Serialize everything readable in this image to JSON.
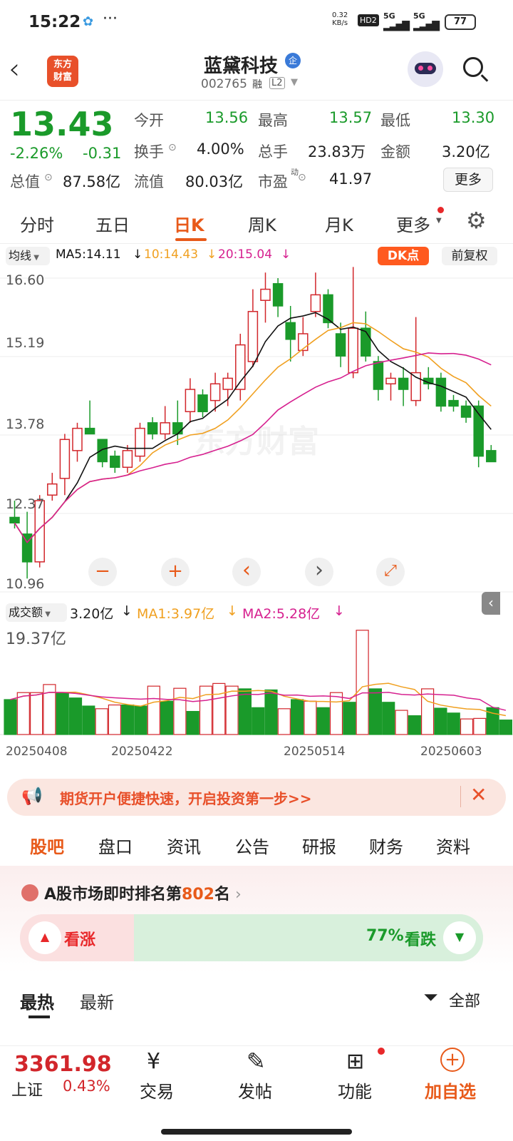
{
  "status": {
    "time": "15:22",
    "net_speed": "0.32",
    "net_unit": "KB/s",
    "hd": "HD2",
    "sig1": "5G",
    "sig2": "5G",
    "battery": "77"
  },
  "header": {
    "logo_line1": "东方",
    "logo_line2": "财富",
    "title": "蓝黛科技",
    "title_badge": "企",
    "code": "002765",
    "tag_rong": "融",
    "tag_level": "L2"
  },
  "quote": {
    "price": "13.43",
    "change_pct": "-2.26%",
    "change": "-0.31",
    "open_label": "今开",
    "open": "13.56",
    "high_label": "最高",
    "high": "13.57",
    "low_label": "最低",
    "low": "13.30",
    "turnover_label": "换手",
    "turnover": "4.00%",
    "volume_label": "总手",
    "volume": "23.83万",
    "amount_label": "金额",
    "amount": "3.20亿",
    "mktcap_label": "总值",
    "mktcap": "87.58亿",
    "float_label": "流值",
    "float": "80.03亿",
    "pe_label": "市盈",
    "pe_sup": "动",
    "pe": "41.97",
    "more_btn": "更多"
  },
  "tabs": [
    "分时",
    "五日",
    "日K",
    "周K",
    "月K",
    "更多"
  ],
  "active_tab_index": 2,
  "kline": {
    "ma_label": "均线",
    "ma5": "MA5:14.11",
    "ma10": "10:14.43",
    "ma20": "20:15.04",
    "dk_btn": "DK点",
    "adj_btn": "前复权",
    "yticks": [
      "16.60",
      "15.19",
      "13.78",
      "12.37",
      "10.96"
    ],
    "watermark": "东方财富",
    "controls": [
      "−",
      "+",
      "‹",
      "›",
      "⤢"
    ],
    "colors": {
      "ma5": "#111111",
      "ma10": "#f0a020",
      "ma20": "#d6208f",
      "up": "#d2262b",
      "down": "#1a9a2a"
    }
  },
  "chart_data": {
    "type": "candlestick",
    "candles": [
      [
        12.3,
        12.6,
        12.1,
        12.2
      ],
      [
        12.0,
        12.4,
        11.2,
        11.5
      ],
      [
        11.5,
        12.7,
        11.4,
        12.6
      ],
      [
        12.7,
        13.1,
        12.6,
        12.9
      ],
      [
        13.0,
        13.8,
        12.7,
        13.7
      ],
      [
        13.5,
        14.0,
        13.3,
        13.9
      ],
      [
        13.9,
        14.4,
        13.8,
        13.8
      ],
      [
        13.7,
        13.7,
        13.2,
        13.3
      ],
      [
        13.4,
        13.5,
        13.1,
        13.2
      ],
      [
        13.2,
        13.6,
        13.1,
        13.5
      ],
      [
        13.4,
        14.0,
        13.3,
        13.9
      ],
      [
        14.0,
        14.1,
        13.7,
        13.8
      ],
      [
        13.8,
        14.3,
        13.7,
        14.0
      ],
      [
        14.0,
        14.4,
        13.6,
        13.8
      ],
      [
        14.2,
        14.8,
        14.0,
        14.6
      ],
      [
        14.5,
        14.6,
        14.1,
        14.2
      ],
      [
        14.4,
        14.9,
        14.2,
        14.7
      ],
      [
        14.6,
        14.9,
        14.3,
        14.8
      ],
      [
        14.6,
        15.6,
        14.4,
        15.4
      ],
      [
        15.1,
        16.4,
        15.0,
        16.0
      ],
      [
        16.2,
        16.7,
        15.8,
        16.4
      ],
      [
        16.5,
        16.6,
        15.9,
        16.1
      ],
      [
        15.8,
        16.1,
        15.1,
        15.5
      ],
      [
        15.3,
        15.9,
        15.2,
        15.6
      ],
      [
        16.0,
        16.7,
        15.9,
        16.3
      ],
      [
        16.3,
        16.4,
        15.7,
        15.8
      ],
      [
        15.6,
        15.8,
        15.0,
        15.2
      ],
      [
        14.9,
        16.8,
        14.8,
        15.7
      ],
      [
        15.7,
        16.0,
        15.1,
        15.2
      ],
      [
        15.1,
        15.2,
        14.4,
        14.6
      ],
      [
        14.7,
        14.9,
        14.4,
        14.8
      ],
      [
        14.8,
        15.0,
        14.3,
        14.6
      ],
      [
        14.4,
        15.9,
        14.3,
        14.9
      ],
      [
        14.8,
        15.0,
        14.6,
        14.7
      ],
      [
        14.8,
        14.9,
        14.2,
        14.3
      ],
      [
        14.4,
        14.5,
        14.2,
        14.3
      ],
      [
        14.3,
        14.4,
        14.0,
        14.1
      ],
      [
        14.3,
        14.4,
        13.2,
        13.4
      ],
      [
        13.5,
        13.6,
        13.3,
        13.3
      ]
    ],
    "yrange": [
      10.96,
      16.6
    ]
  },
  "volume": {
    "label": "成交额",
    "value": "3.20亿",
    "ma1": "MA1:3.97亿",
    "ma2": "MA2:5.28亿",
    "ymax": "19.37亿",
    "dates": [
      "20250408",
      "20250422",
      "20250514",
      "20250603"
    ],
    "bars": [
      6.5,
      7.8,
      7.8,
      9.3,
      7.7,
      6.8,
      5.3,
      4.8,
      5.5,
      5.5,
      5.3,
      9.0,
      6.2,
      8.6,
      4.3,
      9.0,
      9.5,
      9.0,
      8.5,
      5.0,
      8.3,
      4.8,
      6.5,
      6.2,
      5.0,
      7.8,
      6.0,
      19.4,
      8.5,
      6.0,
      4.5,
      3.5,
      8.5,
      4.9,
      4.0,
      2.9,
      3.0,
      5.0,
      2.7
    ],
    "bar_up": [
      0,
      1,
      1,
      1,
      0,
      0,
      0,
      1,
      1,
      0,
      0,
      1,
      0,
      1,
      0,
      1,
      1,
      1,
      0,
      0,
      0,
      1,
      0,
      1,
      0,
      1,
      0,
      1,
      0,
      0,
      1,
      0,
      1,
      0,
      0,
      1,
      1,
      0,
      0
    ]
  },
  "promo": {
    "text": "期货开户便捷快速，开启投资第一步>>"
  },
  "subtabs": [
    "股吧",
    "盘口",
    "资讯",
    "公告",
    "研报",
    "财务",
    "资料"
  ],
  "rank": {
    "prefix": "A股市场即时排名第",
    "num": "802",
    "suffix": "名"
  },
  "sentiment": {
    "bull": "看涨",
    "bear_pct": "77%",
    "bear": "看跌"
  },
  "feed": {
    "hot": "最热",
    "new": "最新",
    "filter": "全部"
  },
  "bottom": {
    "index_value": "3361.98",
    "index_name": "上证",
    "index_change": "0.43%",
    "trade": "交易",
    "post": "发帖",
    "func": "功能",
    "add": "加自选"
  }
}
